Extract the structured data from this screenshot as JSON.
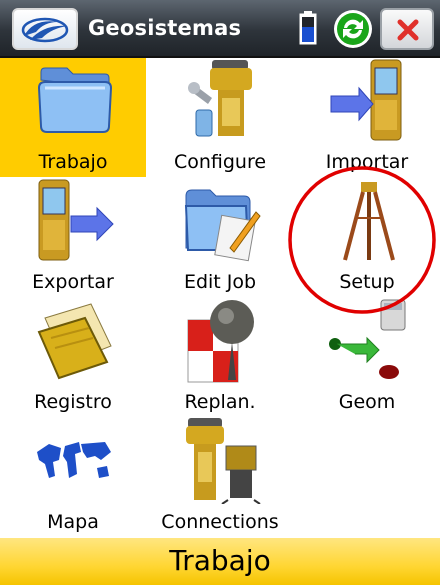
{
  "titlebar": {
    "app_title": "Geosistemas",
    "logo_icon": "topcon-logo-icon",
    "battery_icon": "battery-icon",
    "sync_icon": "sync-icon",
    "close_icon": "close-icon"
  },
  "menu": {
    "items": [
      {
        "label": "Trabajo",
        "icon": "folder-icon",
        "selected": true
      },
      {
        "label": "Configure",
        "icon": "configure-icon",
        "selected": false
      },
      {
        "label": "Importar",
        "icon": "import-icon",
        "selected": false
      },
      {
        "label": "Exportar",
        "icon": "export-icon",
        "selected": false
      },
      {
        "label": "Edit Job",
        "icon": "edit-job-icon",
        "selected": false
      },
      {
        "label": "Setup",
        "icon": "tripod-icon",
        "selected": false
      },
      {
        "label": "Registro",
        "icon": "notebook-icon",
        "selected": false
      },
      {
        "label": "Replan.",
        "icon": "stakeout-icon",
        "selected": false
      },
      {
        "label": "Geom",
        "icon": "calculator-icon",
        "selected": false
      },
      {
        "label": "Mapa",
        "icon": "world-map-icon",
        "selected": false
      },
      {
        "label": "Connections",
        "icon": "connections-icon",
        "selected": false
      }
    ]
  },
  "statusbar": {
    "text": "Trabajo"
  },
  "colors": {
    "selected": "#ffcc00",
    "titlebar": "#2e343b",
    "annotation": "#e00000"
  }
}
